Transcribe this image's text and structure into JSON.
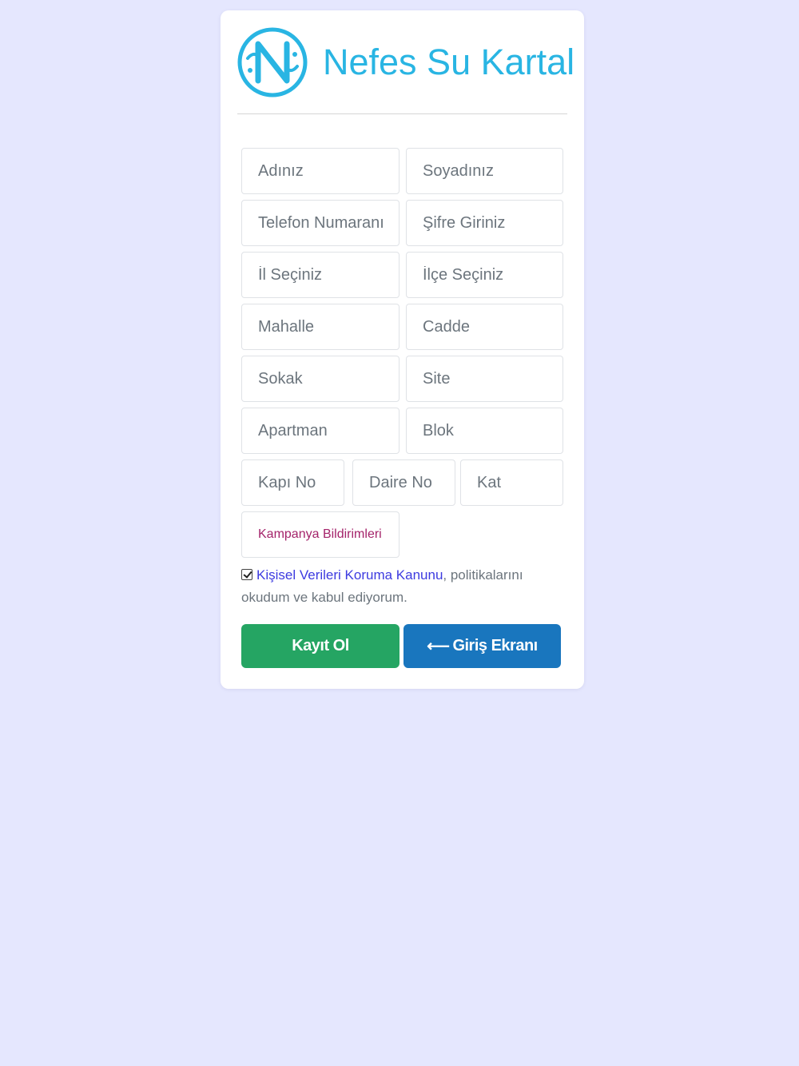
{
  "brand": {
    "name": "Nefes Su Kartal",
    "logo_icon": "water-n-logo-icon",
    "color": "#29b5e3"
  },
  "form": {
    "first_name_placeholder": "Adınız",
    "last_name_placeholder": "Soyadınız",
    "phone_placeholder": "Telefon Numaranız",
    "password_placeholder": "Şifre Giriniz",
    "province_placeholder": "İl Seçiniz",
    "district_placeholder": "İlçe Seçiniz",
    "neighborhood_placeholder": "Mahalle",
    "avenue_placeholder": "Cadde",
    "street_placeholder": "Sokak",
    "site_placeholder": "Site",
    "apartment_placeholder": "Apartman",
    "block_placeholder": "Blok",
    "door_no_placeholder": "Kapı No",
    "flat_no_placeholder": "Daire No",
    "floor_placeholder": "Kat",
    "campaign_placeholder": "Kampanya Bildirimleri"
  },
  "consent": {
    "link_text": "Kişisel Verileri Koruma Kanunu",
    "rest_text": ", politikalarını okudum ve kabul ediyorum.",
    "checked": true
  },
  "buttons": {
    "register_label": "Kayıt Ol",
    "login_arrow": "⟵",
    "login_label": "Giriş Ekranı",
    "register_color": "#25a563",
    "login_color": "#1976be"
  }
}
